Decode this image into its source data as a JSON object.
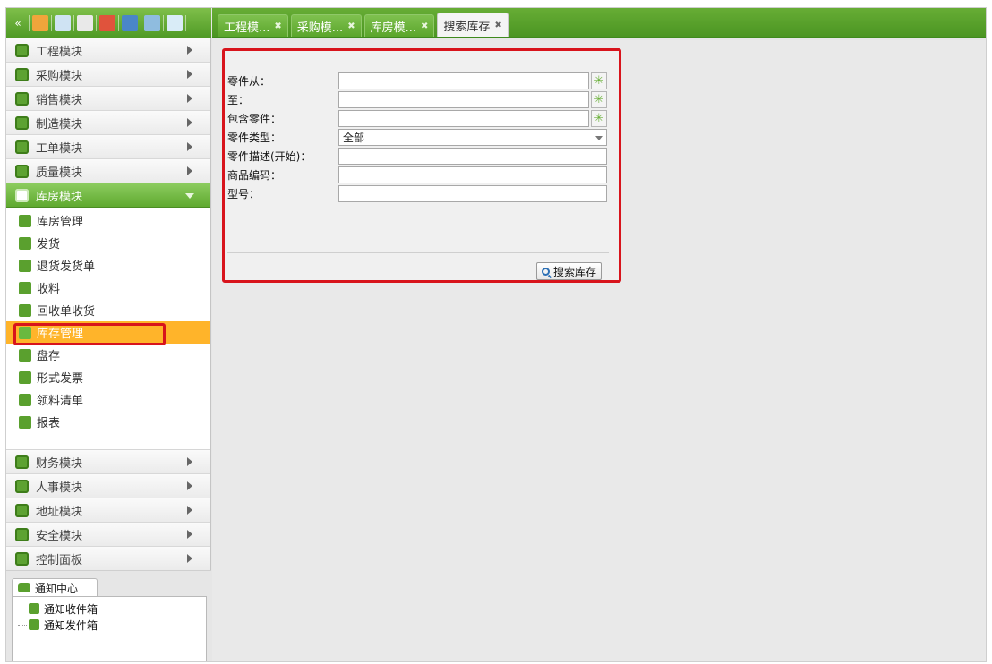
{
  "toolbar": {
    "icons": [
      "collapse-icon",
      "users-icon",
      "mail-icon",
      "document-icon",
      "chart-icon",
      "window-icon",
      "copy-icon",
      "home-icon"
    ]
  },
  "tabs": [
    {
      "label": "工程模...",
      "active": false
    },
    {
      "label": "采购模...",
      "active": false
    },
    {
      "label": "库房模...",
      "active": false
    },
    {
      "label": "搜索库存",
      "active": true
    }
  ],
  "sidebar": {
    "modules_top": [
      {
        "label": "工程模块"
      },
      {
        "label": "采购模块"
      },
      {
        "label": "销售模块"
      },
      {
        "label": "制造模块"
      },
      {
        "label": "工单模块"
      },
      {
        "label": "质量模块"
      }
    ],
    "open_module": {
      "label": "库房模块"
    },
    "subitems": [
      {
        "label": "库房管理",
        "selected": false
      },
      {
        "label": "发货",
        "selected": false
      },
      {
        "label": "退货发货单",
        "selected": false
      },
      {
        "label": "收料",
        "selected": false
      },
      {
        "label": "回收单收货",
        "selected": false
      },
      {
        "label": "库存管理",
        "selected": true
      },
      {
        "label": "盘存",
        "selected": false
      },
      {
        "label": "形式发票",
        "selected": false
      },
      {
        "label": "领料清单",
        "selected": false
      },
      {
        "label": "报表",
        "selected": false
      }
    ],
    "modules_bottom": [
      {
        "label": "财务模块"
      },
      {
        "label": "人事模块"
      },
      {
        "label": "地址模块"
      },
      {
        "label": "安全模块"
      },
      {
        "label": "控制面板"
      }
    ]
  },
  "notify": {
    "tab_label": "通知中心",
    "items": [
      "通知收件箱",
      "通知发件箱"
    ]
  },
  "form": {
    "fields": [
      {
        "label": "零件从：",
        "value": "",
        "type": "picker"
      },
      {
        "label": "至：",
        "value": "",
        "type": "picker"
      },
      {
        "label": "包含零件：",
        "value": "",
        "type": "picker"
      },
      {
        "label": "零件类型：",
        "value": "全部",
        "type": "select"
      },
      {
        "label": "零件描述(开始)：",
        "value": "",
        "type": "text"
      },
      {
        "label": "商品编码：",
        "value": "",
        "type": "text"
      },
      {
        "label": "型号：",
        "value": "",
        "type": "text"
      }
    ],
    "search_button": "搜索库存"
  },
  "colors": {
    "accent_green": "#5aa52b",
    "selection_orange": "#ffb42a",
    "highlight_red": "#d8141c"
  }
}
